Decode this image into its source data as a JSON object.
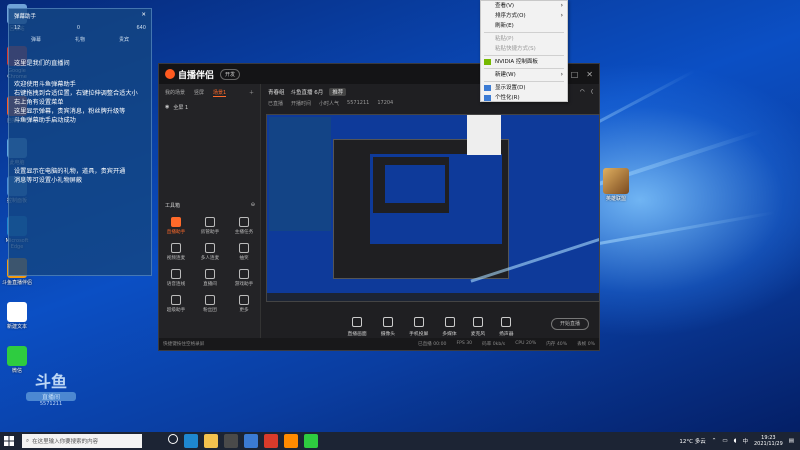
{
  "desktop": {
    "icons_left": [
      {
        "label": "回收站",
        "color": "#6fa3d8"
      },
      {
        "label": "Google Chrome",
        "color": "#d93b2b"
      },
      {
        "label": "自播伴侣",
        "color": "#ff5a1f"
      },
      {
        "label": "此电脑",
        "color": "#5fa8e0"
      },
      {
        "label": "控制面板",
        "color": "#4a90d9"
      },
      {
        "label": "Microsoft Edge",
        "color": "#1e88d0"
      },
      {
        "label": "斗鱼直播伴侣",
        "color": "#f39c12"
      },
      {
        "label": "新建文本",
        "color": "#ffffff"
      },
      {
        "label": "微信",
        "color": "#2ecc40"
      }
    ],
    "icon_right": {
      "label": "英雄联盟",
      "color": "#b07a3a"
    },
    "watermark": {
      "line1": "斗鱼",
      "line2": "直播间",
      "line3": "5571211"
    }
  },
  "chat_panel": {
    "title": "弹幕助手",
    "stats": {
      "viewers": "12",
      "fans": "0",
      "likes": "640"
    },
    "tabs": [
      "弹幕",
      "礼物",
      "贵宾"
    ],
    "messages": [
      "这里是我们的直播间",
      "欢迎使用斗鱼弹幕助手",
      "右键拖拽到合适位置，右键拉伸调整合适大小",
      "右上角有设置菜单",
      "这里显示弹幕，贵宾消息，粉丝牌升级等",
      "斗鱼弹幕助手启动成功",
      "设置显示在电脑的礼物，道具，贵宾开通",
      "消息等可设置小礼物屏蔽"
    ]
  },
  "app": {
    "title": "自播伴侣",
    "badge": "开发",
    "window_controls": [
      "—",
      "□",
      "✕"
    ],
    "left_tabs": [
      {
        "label": "我的场景",
        "active": false
      },
      {
        "label": "竖屏",
        "active": false
      },
      {
        "label": "场景1",
        "active": true
      }
    ],
    "scene_item": "全屏 1",
    "tools_header": "工具箱",
    "tools": [
      {
        "label": "直播助手",
        "hot": true
      },
      {
        "label": "房管助手",
        "hot": false
      },
      {
        "label": "主播任务",
        "hot": false
      },
      {
        "label": "视频连麦",
        "hot": false
      },
      {
        "label": "多人连麦",
        "hot": false
      },
      {
        "label": "抽奖",
        "hot": false
      },
      {
        "label": "语音连线",
        "hot": false
      },
      {
        "label": "直播间",
        "hot": false
      },
      {
        "label": "游戏助手",
        "hot": false
      },
      {
        "label": "超级助手",
        "hot": false
      },
      {
        "label": "粉丝团",
        "hot": false
      },
      {
        "label": "更多",
        "hot": false
      }
    ],
    "stream_title": "青春组",
    "stream_subtitle": "斗鱼直播 6月",
    "stream_tag": "推荐",
    "stream_meta": [
      "已直播",
      "开播时间",
      "小时人气",
      "5571211"
    ],
    "viewers_count": "17204",
    "bottom_tools": [
      "直播画面",
      "摄像头",
      "手机投屏",
      "多媒体",
      "麦克风",
      "扬声器"
    ],
    "go_live_label": "开始直播",
    "status_left": "快捷键按住空格录屏",
    "status_right": [
      "已直播 00:00",
      "FPS 30",
      "码率 0kb/s",
      "CPU 20%",
      "内存 40%",
      "丢帧 0%"
    ]
  },
  "context_menu": {
    "items": [
      {
        "label": "查看(V)",
        "disabled": false,
        "arrow": true
      },
      {
        "label": "排序方式(O)",
        "disabled": false,
        "arrow": true
      },
      {
        "label": "刷新(E)",
        "disabled": false,
        "arrow": false
      },
      {
        "sep": true
      },
      {
        "label": "粘贴(P)",
        "disabled": true,
        "arrow": false
      },
      {
        "label": "粘贴快捷方式(S)",
        "disabled": true,
        "arrow": false
      },
      {
        "sep": true
      },
      {
        "label": "NVIDIA 控制面板",
        "disabled": false,
        "arrow": false,
        "icon": "nvidia-icon"
      },
      {
        "sep": true
      },
      {
        "label": "新建(W)",
        "disabled": false,
        "arrow": true
      },
      {
        "sep": true
      },
      {
        "label": "显示设置(D)",
        "disabled": false,
        "arrow": false,
        "icon": "display-icon"
      },
      {
        "label": "个性化(R)",
        "disabled": false,
        "arrow": false,
        "icon": "personalize-icon"
      }
    ]
  },
  "taskbar": {
    "search_placeholder": "在这里输入你要搜索的内容",
    "pinned": [
      "task-view",
      "edge",
      "explorer",
      "store",
      "mail",
      "chrome",
      "douyu",
      "wechat"
    ],
    "weather": "12°C 多云",
    "time": "19:23",
    "date": "2021/11/29"
  },
  "colors": {
    "accent": "#ff6a2a",
    "app_bg": "#1f1f22",
    "taskbar": "#1c2434"
  }
}
